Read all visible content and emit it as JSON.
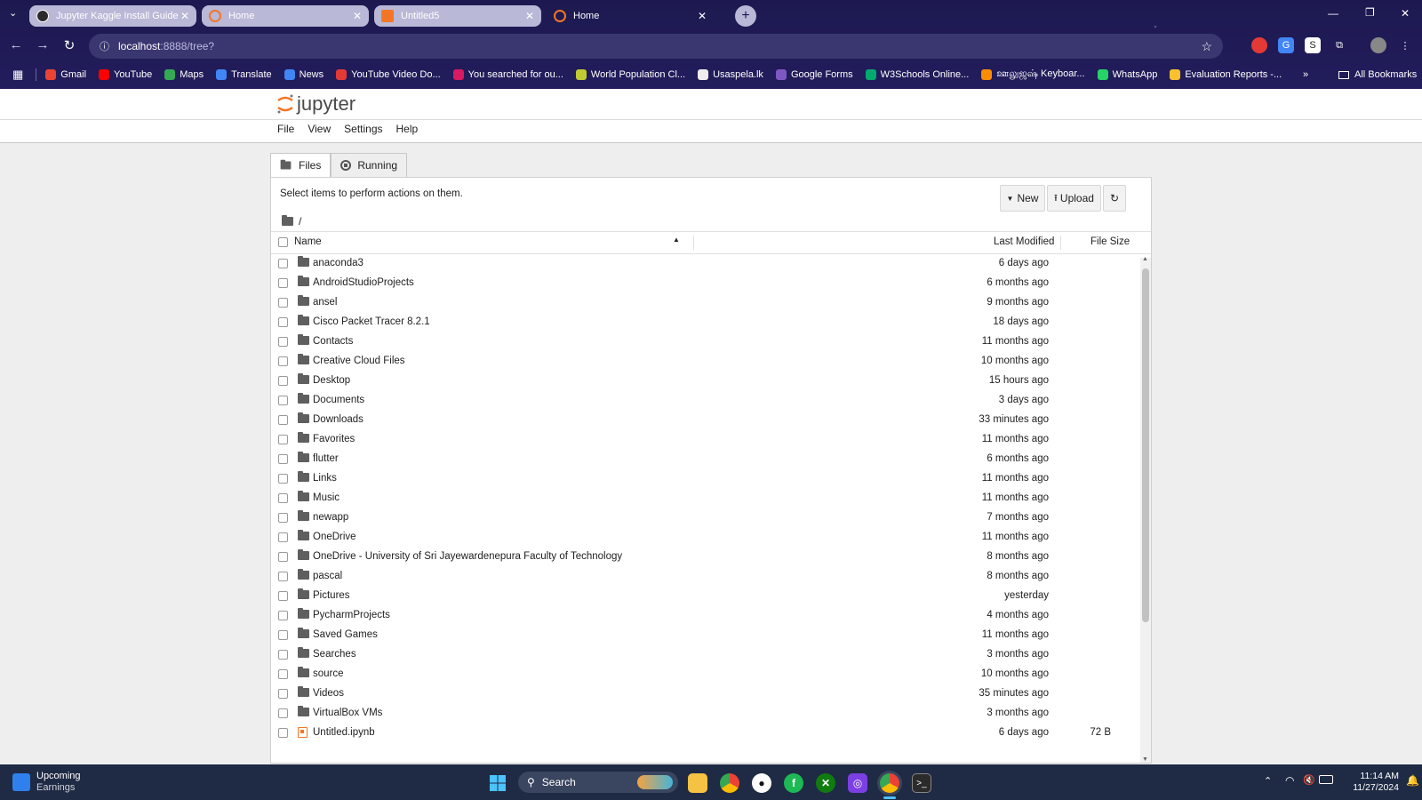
{
  "browser": {
    "tabs": [
      {
        "title": "Jupyter Kaggle Install Guide",
        "active": false
      },
      {
        "title": "Home",
        "active": false
      },
      {
        "title": "Untitled5",
        "active": false
      },
      {
        "title": "Home",
        "active": true
      }
    ],
    "close_glyph": "✕",
    "new_tab_glyph": "+",
    "address": {
      "host": "localhost",
      "path": ":8888/tree?"
    },
    "window_controls": {
      "minimize": "—",
      "restore": "❐",
      "close": "✕"
    },
    "bookmarks": [
      {
        "label": "Gmail",
        "color": "#ea4335"
      },
      {
        "label": "YouTube",
        "color": "#ff0000"
      },
      {
        "label": "Maps",
        "color": "#34a853"
      },
      {
        "label": "Translate",
        "color": "#4285f4"
      },
      {
        "label": "News",
        "color": "#4285f4"
      },
      {
        "label": "YouTube Video Do...",
        "color": "#e53935"
      },
      {
        "label": "You searched for ou...",
        "color": "#d81b60"
      },
      {
        "label": "World Population Cl...",
        "color": "#c0ca33"
      },
      {
        "label": "Usaspela.lk",
        "color": "#eeeeee"
      },
      {
        "label": "Google Forms",
        "color": "#7e57c2"
      },
      {
        "label": "W3Schools Online...",
        "color": "#04aa6d"
      },
      {
        "label": "ஊலுஜஷ் Keyboar...",
        "color": "#fb8c00"
      },
      {
        "label": "WhatsApp",
        "color": "#25d366"
      },
      {
        "label": "Evaluation Reports -...",
        "color": "#fbc02d"
      }
    ],
    "more_bookmarks": "»",
    "all_bookmarks": "All Bookmarks"
  },
  "jupyter": {
    "logo_text": "jupyter",
    "menu": [
      "File",
      "View",
      "Settings",
      "Help"
    ],
    "tabs": [
      {
        "label": "Files",
        "active": true
      },
      {
        "label": "Running",
        "active": false
      }
    ],
    "instruction": "Select items to perform actions on them.",
    "buttons": {
      "new": "New",
      "upload": "Upload",
      "refresh": "↻"
    },
    "breadcrumb": "/",
    "columns": {
      "name": "Name",
      "last_modified": "Last Modified",
      "file_size": "File Size"
    },
    "files": [
      {
        "name": "anaconda3",
        "modified": "6 days ago",
        "size": "",
        "type": "folder"
      },
      {
        "name": "AndroidStudioProjects",
        "modified": "6 months ago",
        "size": "",
        "type": "folder"
      },
      {
        "name": "ansel",
        "modified": "9 months ago",
        "size": "",
        "type": "folder"
      },
      {
        "name": "Cisco Packet Tracer 8.2.1",
        "modified": "18 days ago",
        "size": "",
        "type": "folder"
      },
      {
        "name": "Contacts",
        "modified": "11 months ago",
        "size": "",
        "type": "folder"
      },
      {
        "name": "Creative Cloud Files",
        "modified": "10 months ago",
        "size": "",
        "type": "folder"
      },
      {
        "name": "Desktop",
        "modified": "15 hours ago",
        "size": "",
        "type": "folder"
      },
      {
        "name": "Documents",
        "modified": "3 days ago",
        "size": "",
        "type": "folder"
      },
      {
        "name": "Downloads",
        "modified": "33 minutes ago",
        "size": "",
        "type": "folder"
      },
      {
        "name": "Favorites",
        "modified": "11 months ago",
        "size": "",
        "type": "folder"
      },
      {
        "name": "flutter",
        "modified": "6 months ago",
        "size": "",
        "type": "folder"
      },
      {
        "name": "Links",
        "modified": "11 months ago",
        "size": "",
        "type": "folder"
      },
      {
        "name": "Music",
        "modified": "11 months ago",
        "size": "",
        "type": "folder"
      },
      {
        "name": "newapp",
        "modified": "7 months ago",
        "size": "",
        "type": "folder"
      },
      {
        "name": "OneDrive",
        "modified": "11 months ago",
        "size": "",
        "type": "folder"
      },
      {
        "name": "OneDrive - University of Sri Jayewardenepura Faculty of Technology",
        "modified": "8 months ago",
        "size": "",
        "type": "folder"
      },
      {
        "name": "pascal",
        "modified": "8 months ago",
        "size": "",
        "type": "folder"
      },
      {
        "name": "Pictures",
        "modified": "yesterday",
        "size": "",
        "type": "folder"
      },
      {
        "name": "PycharmProjects",
        "modified": "4 months ago",
        "size": "",
        "type": "folder"
      },
      {
        "name": "Saved Games",
        "modified": "11 months ago",
        "size": "",
        "type": "folder"
      },
      {
        "name": "Searches",
        "modified": "3 months ago",
        "size": "",
        "type": "folder"
      },
      {
        "name": "source",
        "modified": "10 months ago",
        "size": "",
        "type": "folder"
      },
      {
        "name": "Videos",
        "modified": "35 minutes ago",
        "size": "",
        "type": "folder"
      },
      {
        "name": "VirtualBox VMs",
        "modified": "3 months ago",
        "size": "",
        "type": "folder"
      },
      {
        "name": "Untitled.ipynb",
        "modified": "6 days ago",
        "size": "72 B",
        "type": "notebook"
      }
    ]
  },
  "taskbar": {
    "widget_title": "Upcoming",
    "widget_subtitle": "Earnings",
    "search_label": "Search",
    "time": "11:14 AM",
    "date": "11/27/2024"
  }
}
